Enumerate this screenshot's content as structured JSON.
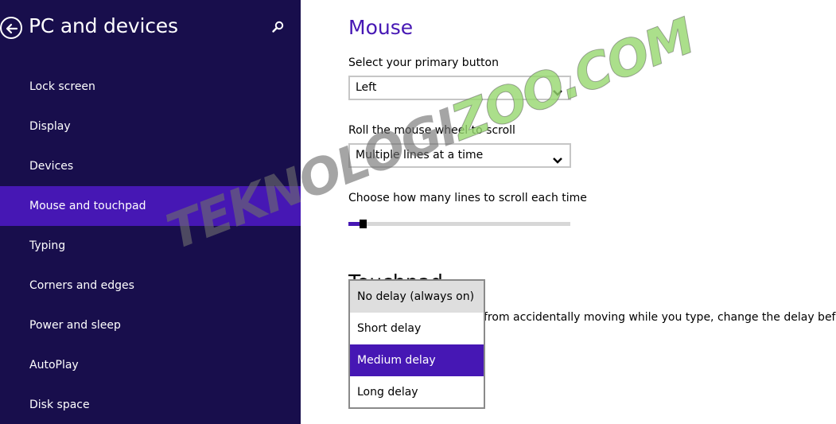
{
  "sidebar": {
    "title": "PC and devices",
    "back_icon": "back-arrow-icon",
    "search_icon": "search-icon",
    "items": [
      {
        "label": "Lock screen"
      },
      {
        "label": "Display"
      },
      {
        "label": "Devices"
      },
      {
        "label": "Mouse and touchpad",
        "active": true
      },
      {
        "label": "Typing"
      },
      {
        "label": "Corners and edges"
      },
      {
        "label": "Power and sleep"
      },
      {
        "label": "AutoPlay"
      },
      {
        "label": "Disk space"
      }
    ]
  },
  "main": {
    "title": "Mouse",
    "primary_button": {
      "label": "Select your primary button",
      "value": "Left"
    },
    "wheel_scroll": {
      "label": "Roll the mouse wheel to scroll",
      "value": "Multiple lines at a time"
    },
    "lines_scroll": {
      "label": "Choose how many lines to scroll each time",
      "level": 0.05
    },
    "touchpad": {
      "heading": "Touchpad",
      "description": "from accidentally moving while you type, change the delay before"
    }
  },
  "dropdown": {
    "options": [
      {
        "label": "No delay (always on)",
        "state": "hover"
      },
      {
        "label": "Short delay",
        "state": "normal"
      },
      {
        "label": "Medium delay",
        "state": "selected"
      },
      {
        "label": "Long delay",
        "state": "normal"
      }
    ]
  },
  "watermark": {
    "text_a": "TEKNOLOGI",
    "text_b": "ZOO",
    "text_c": ".COM"
  },
  "colors": {
    "sidebar_bg": "#180e4c",
    "accent": "#4617b4",
    "title": "#4617b4"
  }
}
